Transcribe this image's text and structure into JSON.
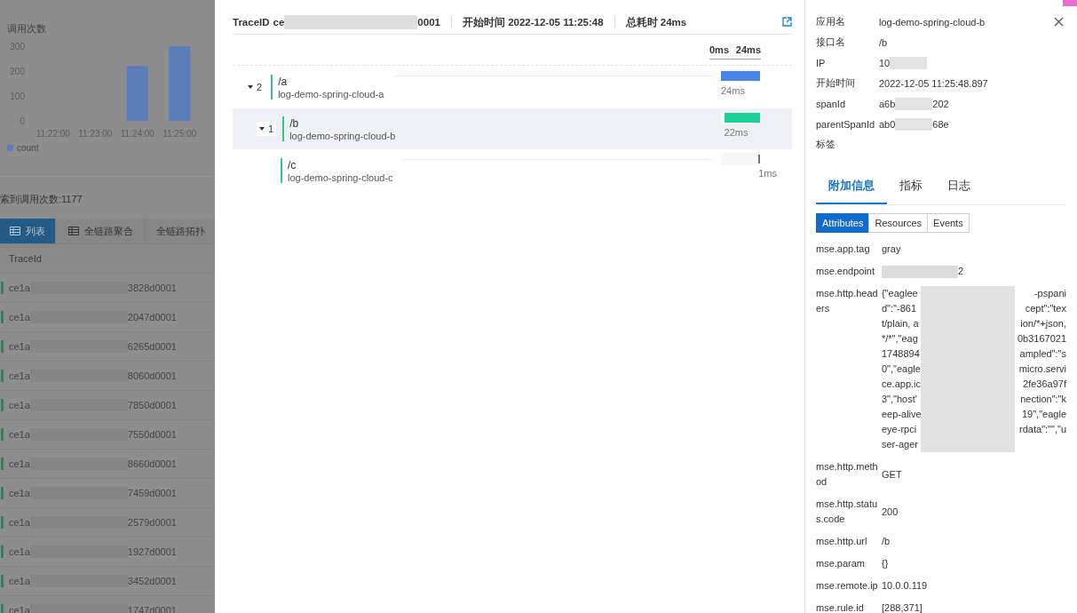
{
  "left": {
    "chart": {
      "chart_data": {
        "type": "bar",
        "title": "调用次数",
        "categories": [
          "11:22:00",
          "11:23:00",
          "11:24:00",
          "11:25:00"
        ],
        "yticks": [
          0,
          100,
          200,
          300
        ],
        "ylim": [
          0,
          300
        ],
        "series": [
          {
            "name": "count",
            "color": "#5a7cb8",
            "values": [
              0,
              0,
              220,
              300
            ]
          }
        ]
      }
    },
    "result_count": "索到调用次数:1177",
    "tabs": [
      {
        "label": "列表",
        "kind": "icon",
        "selected": true
      },
      {
        "label": "全链路聚合",
        "kind": "icon",
        "selected": false
      },
      {
        "label": "全链路拓扑",
        "kind": "plain",
        "selected": false
      }
    ],
    "table": {
      "columns": [
        "TraceId"
      ],
      "rows": [
        {
          "prefix": "ce1a",
          "redacted": true,
          "suffix": "3828d0001"
        },
        {
          "prefix": "ce1a",
          "redacted": true,
          "suffix": "2047d0001"
        },
        {
          "prefix": "ce1a",
          "redacted": true,
          "suffix": "6265d0001"
        },
        {
          "prefix": "ce1a",
          "redacted": true,
          "suffix": "8060d0001"
        },
        {
          "prefix": "ce1a",
          "redacted": true,
          "suffix": "7850d0001"
        },
        {
          "prefix": "ce1a",
          "redacted": true,
          "suffix": "7550d0001"
        },
        {
          "prefix": "ce1a",
          "redacted": true,
          "suffix": "8660d0001"
        },
        {
          "prefix": "ce1a",
          "redacted": true,
          "suffix": "7459d0001"
        },
        {
          "prefix": "ce1a",
          "redacted": true,
          "suffix": "2579d0001"
        },
        {
          "prefix": "ce1a",
          "redacted": true,
          "suffix": "1927d0001"
        },
        {
          "prefix": "ce1a",
          "redacted": true,
          "suffix": "3452d0001"
        },
        {
          "prefix": "ce1a",
          "redacted": true,
          "suffix": "1747d0001"
        }
      ]
    }
  },
  "trace": {
    "header": {
      "trace_id": {
        "label": "TraceID",
        "prefix": "ce",
        "redacted": true,
        "suffix": "0001"
      },
      "start_time": "开始时间 2022-12-05 11:25:48",
      "duration": "总耗时 24ms"
    },
    "scale": {
      "start": "0ms",
      "end": "24ms"
    },
    "spans": [
      {
        "path": "/a",
        "service": "log-demo-spring-cloud-a",
        "count": "2",
        "expanded": true,
        "selected": false,
        "duration": "24ms",
        "level": 1,
        "color": "#4a86e8",
        "children": [
          {
            "path": "/b",
            "service": "log-demo-spring-cloud-b",
            "count": "1",
            "expanded": true,
            "selected": true,
            "duration": "22ms",
            "level": 0.92,
            "color": "#1ccf94",
            "children": [
              {
                "path": "/c",
                "service": "log-demo-spring-cloud-c",
                "selected": false,
                "duration": "1ms",
                "level": 0.04,
                "color": "#6b7280"
              }
            ]
          }
        ]
      }
    ]
  },
  "detail": {
    "fields": [
      {
        "label": "应用名",
        "value": "log-demo-spring-cloud-b"
      },
      {
        "label": "接口名",
        "value": "/b"
      },
      {
        "label": "IP",
        "prefix": "10",
        "redacted": true
      },
      {
        "label": "开始时间",
        "value": "2022-12-05 11:25:48.897"
      },
      {
        "label": "spanId",
        "prefix": "a6b",
        "redacted": true,
        "suffix": "202"
      },
      {
        "label": "parentSpanId",
        "prefix": "ab0",
        "redacted": true,
        "suffix": "68e"
      },
      {
        "label": "标签"
      }
    ],
    "tabs": [
      {
        "label": "附加信息",
        "selected": true
      },
      {
        "label": "指标",
        "selected": false
      },
      {
        "label": "日志",
        "selected": false
      }
    ],
    "segments": [
      {
        "label": "Attributes",
        "selected": true
      },
      {
        "label": "Resources",
        "selected": false
      },
      {
        "label": "Events",
        "selected": false
      }
    ],
    "attributes": [
      {
        "key": "mse.app.tag",
        "value": "gray"
      },
      {
        "key": "mse.endpoint",
        "redacted": true,
        "suffix": "2"
      },
      {
        "key": "mse.http.headers",
        "lines": [
          {
            "start": "{\"eaglee",
            "end": "-pspani"
          },
          {
            "start": "d\":\"-861",
            "end": "cept\":\"tex"
          },
          {
            "start": "t/plain, a",
            "end": "ion/*+json,"
          },
          {
            "start": "*/*\",\"eag",
            "end": "0b3167021"
          },
          {
            "start": "1748894",
            "end": "ampled\":\"s"
          },
          {
            "start": "0\",\"eagle",
            "end": "micro.servi"
          },
          {
            "start": "ce.app.ic",
            "end": "2fe36a97f"
          },
          {
            "start": "3\",\"host'",
            "end": "nection\":\"k"
          },
          {
            "start": "eep-alive",
            "end": "19\",\"eagle"
          },
          {
            "start": "eye-rpci",
            "end": "rdata\":\"\",\"u"
          },
          {
            "start": "ser-ager"
          }
        ]
      },
      {
        "key": "mse.http.method",
        "value": "GET"
      },
      {
        "key": "mse.http.status.code",
        "value": "200"
      },
      {
        "key": "mse.http.url",
        "value": "/b"
      },
      {
        "key": "mse.param",
        "value": "{}"
      },
      {
        "key": "mse.remote.ip",
        "value": "10.0.0.119"
      },
      {
        "key": "mse.rule.id",
        "value": "[288,371]"
      }
    ]
  }
}
